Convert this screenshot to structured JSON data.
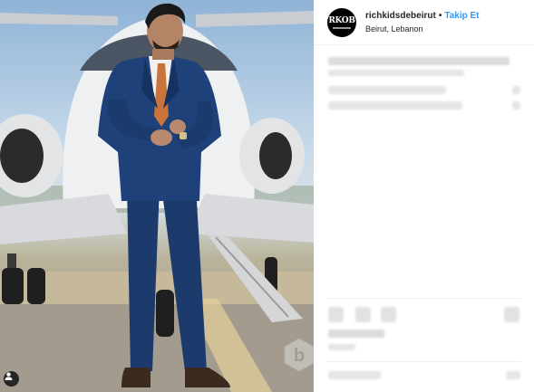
{
  "post": {
    "username": "richkidsdebeirut",
    "separator": "•",
    "follow_label": "Takip Et",
    "location": "Beirut, Lebanon",
    "avatar_text": "RKOB"
  },
  "icons": {
    "user_tag": "person-icon",
    "watermark": "watermark-logo-icon"
  },
  "colors": {
    "follow": "#3897f0",
    "suit": "#1c3a6b",
    "tie": "#c8743a"
  }
}
